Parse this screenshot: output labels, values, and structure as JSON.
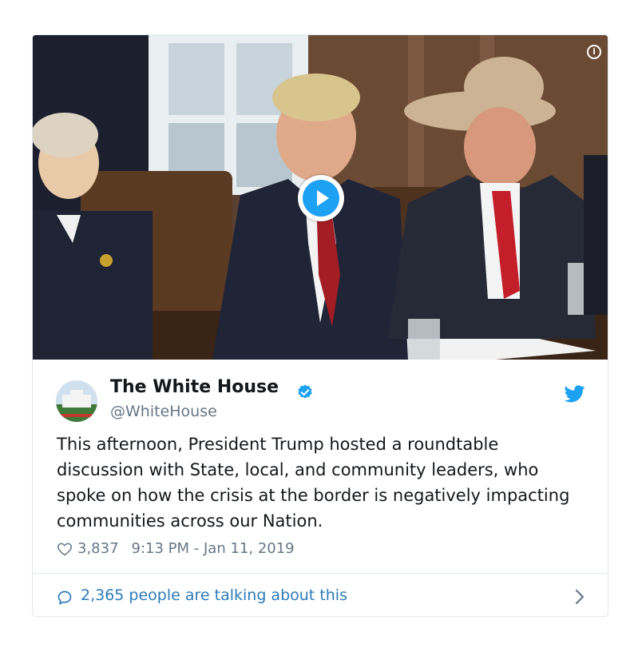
{
  "tweet": {
    "author_name": "The White House",
    "author_handle": "@WhiteHouse",
    "text": "This afternoon, President Trump hosted a roundtable discussion with State, local, and community leaders, who spoke on how the crisis at the border is negatively impacting communities across our Nation.",
    "likes": "3,837",
    "timestamp": "9:13 PM - Jan 11, 2019",
    "talking": "2,365 people are talking about this"
  },
  "icons": {
    "info": "info-icon",
    "play": "play-icon",
    "verified": "verified-badge-icon",
    "bird": "twitter-bird-icon",
    "heart": "heart-icon",
    "bubble": "speech-bubble-icon",
    "chevron": "chevron-right-icon"
  },
  "colors": {
    "accent": "#1da1f2",
    "link": "#2b7bb9",
    "text": "#14171a",
    "muted": "#657786",
    "border": "#e1e8ed"
  }
}
